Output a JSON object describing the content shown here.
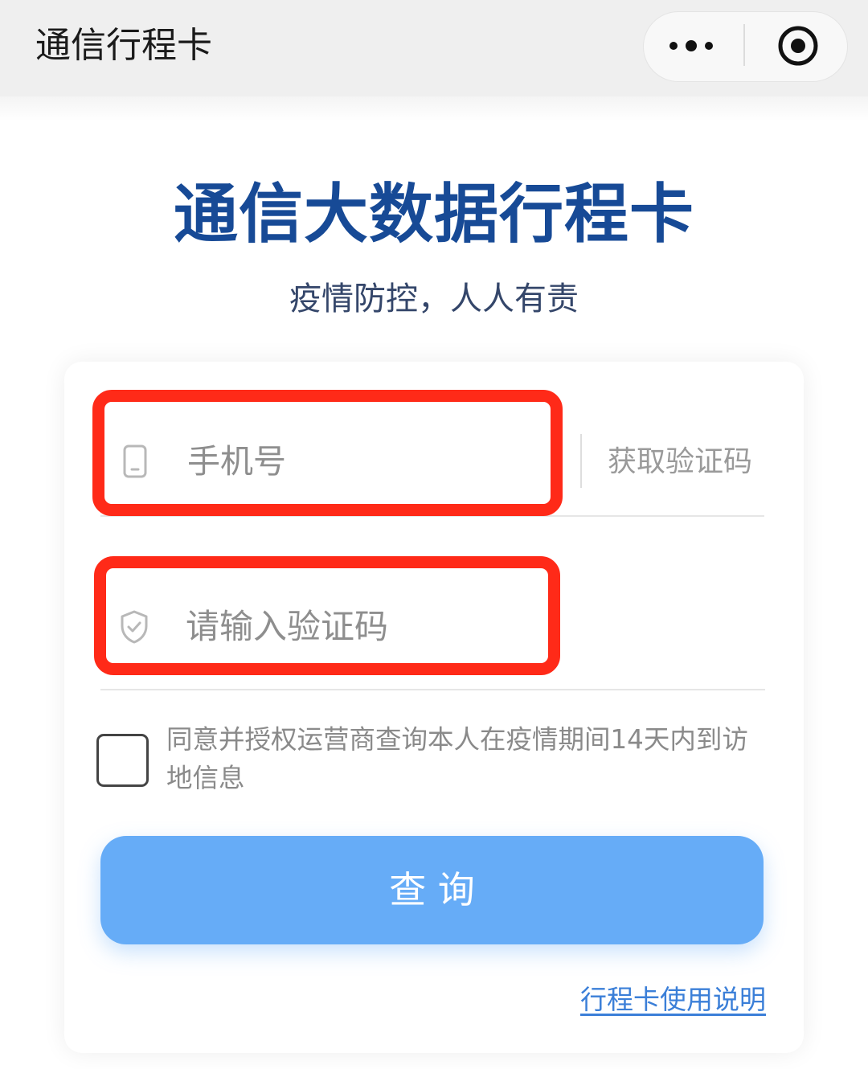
{
  "navbar": {
    "title": "通信行程卡",
    "more_icon": "more-dots-icon",
    "close_icon": "target-icon"
  },
  "header": {
    "title": "通信大数据行程卡",
    "subtitle": "疫情防控，人人有责"
  },
  "form": {
    "phone": {
      "icon": "phone-icon",
      "placeholder": "手机号",
      "value": "",
      "get_code_label": "获取验证码"
    },
    "code": {
      "icon": "shield-check-icon",
      "placeholder": "请输入验证码",
      "value": ""
    },
    "consent": {
      "checked": false,
      "text": "同意并授权运营商查询本人在疫情期间14天内到访地信息"
    },
    "submit_label": "查 询",
    "help_link_label": "行程卡使用说明"
  },
  "colors": {
    "title": "#174a96",
    "subtitle": "#34466a",
    "button": "#66acf7",
    "link": "#3b7fd8",
    "highlight": "#ff2a18",
    "navbar": "#efefef"
  }
}
